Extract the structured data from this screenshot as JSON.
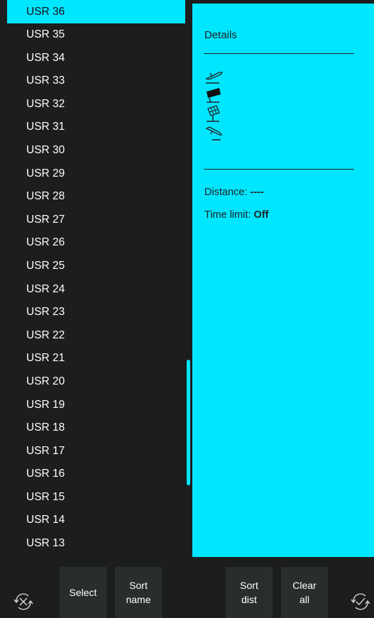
{
  "list": {
    "items": [
      {
        "label": "USR 36",
        "selected": true
      },
      {
        "label": "USR 35"
      },
      {
        "label": "USR 34"
      },
      {
        "label": "USR 33"
      },
      {
        "label": "USR 32"
      },
      {
        "label": "USR 31"
      },
      {
        "label": "USR 30"
      },
      {
        "label": "USR 29"
      },
      {
        "label": "USR 28"
      },
      {
        "label": "USR 27"
      },
      {
        "label": "USR 26"
      },
      {
        "label": "USR 25"
      },
      {
        "label": "USR 24"
      },
      {
        "label": "USR 23"
      },
      {
        "label": "USR 22"
      },
      {
        "label": "USR 21"
      },
      {
        "label": "USR 20"
      },
      {
        "label": "USR 19"
      },
      {
        "label": "USR 18"
      },
      {
        "label": "USR 17"
      },
      {
        "label": "USR 16"
      },
      {
        "label": "USR 15"
      },
      {
        "label": "USR 14"
      },
      {
        "label": "USR 13"
      }
    ]
  },
  "details": {
    "title": "Details",
    "icons": [
      "takeoff-icon",
      "flag-icon",
      "solar-panel-icon",
      "landing-icon"
    ],
    "distance_label": "Distance:",
    "distance_value": "----",
    "time_limit_label": "Time limit:",
    "time_limit_value": "Off"
  },
  "toolbar": {
    "left_icon": "cancel-sync-icon",
    "select_label": "Select",
    "sort_name_label": "Sort name",
    "sort_dist_label": "Sort dist",
    "clear_all_label": "Clear all",
    "right_icon": "confirm-sync-icon"
  },
  "colors": {
    "accent": "#00e6ff",
    "background": "#1c1e1e",
    "button": "#2a2d2d"
  }
}
